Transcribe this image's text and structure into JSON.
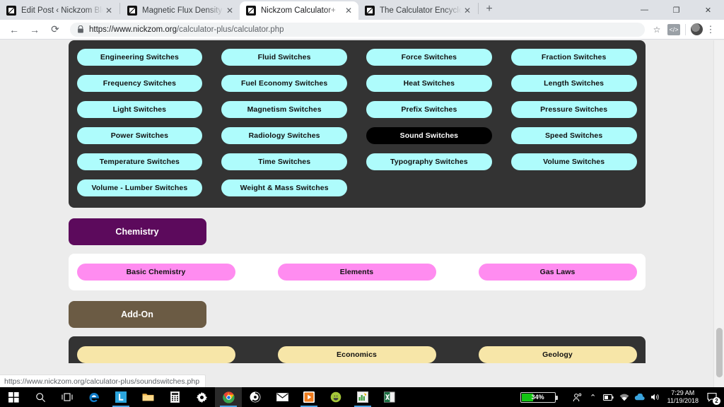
{
  "browser": {
    "tabs": [
      {
        "title": "Edit Post ‹ Nickzom Blog — Wor",
        "active": false
      },
      {
        "title": "Magnetic Flux Density Conversio",
        "active": false
      },
      {
        "title": "Nickzom Calculator+",
        "active": true
      },
      {
        "title": "The Calculator Encyclopedia Com",
        "active": false
      }
    ],
    "new_tab_label": "+",
    "close_label": "✕",
    "window_controls": {
      "minimize": "—",
      "maximize": "❐",
      "close": "✕"
    },
    "nav": {
      "back": "←",
      "forward": "→",
      "reload": "⟳"
    },
    "address": {
      "scheme": "https://www.nickzom.org",
      "path": "/calculator-plus/calculator.php",
      "full": "https://www.nickzom.org/calculator-plus/calculator.php"
    },
    "star_label": "☆",
    "extension_label": "</>",
    "menu_label": "⋮"
  },
  "status_bubble": {
    "url": "https://www.nickzom.org/calculator-plus/soundswitches.php"
  },
  "page": {
    "switches_panel": {
      "buttons": [
        {
          "label": "Engineering Switches",
          "state": "normal"
        },
        {
          "label": "Fluid Switches",
          "state": "normal"
        },
        {
          "label": "Force Switches",
          "state": "normal"
        },
        {
          "label": "Fraction Switches",
          "state": "normal"
        },
        {
          "label": "Frequency Switches",
          "state": "normal"
        },
        {
          "label": "Fuel Economy Switches",
          "state": "normal"
        },
        {
          "label": "Heat Switches",
          "state": "normal"
        },
        {
          "label": "Length Switches",
          "state": "normal"
        },
        {
          "label": "Light Switches",
          "state": "normal"
        },
        {
          "label": "Magnetism Switches",
          "state": "normal"
        },
        {
          "label": "Prefix Switches",
          "state": "normal"
        },
        {
          "label": "Pressure Switches",
          "state": "normal"
        },
        {
          "label": "Power Switches",
          "state": "normal"
        },
        {
          "label": "Radiology Switches",
          "state": "normal"
        },
        {
          "label": "Sound Switches",
          "state": "hover"
        },
        {
          "label": "Speed Switches",
          "state": "normal"
        },
        {
          "label": "Temperature Switches",
          "state": "normal"
        },
        {
          "label": "Time Switches",
          "state": "normal"
        },
        {
          "label": "Typography Switches",
          "state": "normal"
        },
        {
          "label": "Volume Switches",
          "state": "normal"
        },
        {
          "label": "Volume - Lumber Switches",
          "state": "normal"
        },
        {
          "label": "Weight & Mass Switches",
          "state": "normal"
        }
      ]
    },
    "chemistry": {
      "heading": "Chemistry",
      "buttons": [
        {
          "label": "Basic Chemistry"
        },
        {
          "label": "Elements"
        },
        {
          "label": "Gas Laws"
        }
      ]
    },
    "addon": {
      "heading": "Add-On",
      "buttons": [
        {
          "label": ""
        },
        {
          "label": "Economics"
        },
        {
          "label": "Geology"
        }
      ]
    }
  },
  "taskbar": {
    "icons": [
      {
        "name": "start-button"
      },
      {
        "name": "search-icon"
      },
      {
        "name": "task-view-icon"
      },
      {
        "name": "edge-icon"
      },
      {
        "name": "l-app-icon"
      },
      {
        "name": "file-explorer-icon"
      },
      {
        "name": "calculator-icon"
      },
      {
        "name": "settings-icon"
      },
      {
        "name": "chrome-icon"
      },
      {
        "name": "circle-app-icon"
      },
      {
        "name": "mail-icon"
      },
      {
        "name": "media-player-icon"
      },
      {
        "name": "android-studio-icon"
      },
      {
        "name": "chart-app-icon"
      },
      {
        "name": "excel-icon"
      }
    ],
    "tray": {
      "battery_percent": "34%",
      "people_label": "People",
      "chevron": "⌃",
      "time": "7:29 AM",
      "date": "11/19/2018",
      "notification_count": "2"
    }
  }
}
